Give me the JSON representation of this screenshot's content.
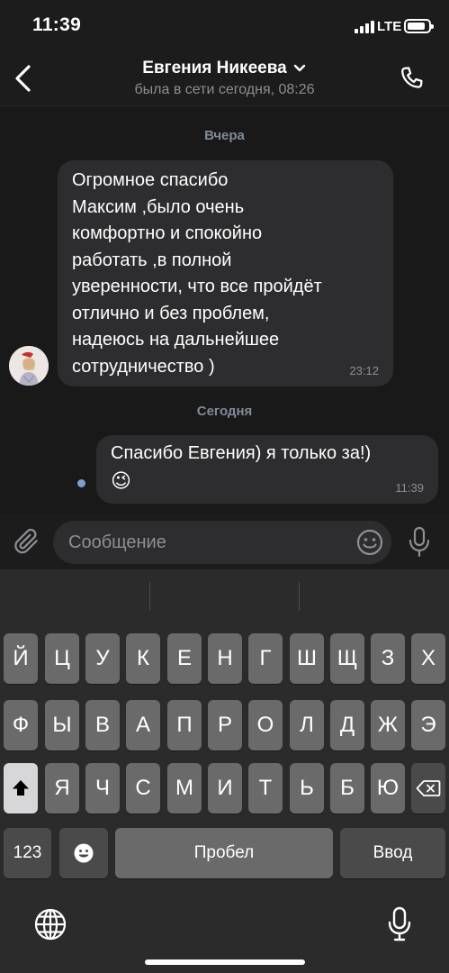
{
  "status_bar": {
    "time": "11:39",
    "network": "LTE"
  },
  "header": {
    "contact_name": "Евгения Никеева",
    "last_seen": "была в сети сегодня, 08:26"
  },
  "chat": {
    "date_separators": [
      "Вчера",
      "Сегодня"
    ],
    "messages": [
      {
        "direction": "incoming",
        "lines": [
          "Огромное спасибо",
          "Максим ,было очень",
          "комфортно и спокойно",
          "работать ,в полной",
          "уверенности, что все пройдёт",
          "отлично и без проблем,",
          "надеюсь на дальнейшее",
          "сотрудничество )"
        ],
        "time": "23:12"
      },
      {
        "direction": "outgoing",
        "text": "Спасибо Евгения) я только за!)",
        "emoji": "😉",
        "time": "11:39",
        "status": "unread"
      }
    ]
  },
  "composer": {
    "placeholder": "Сообщение"
  },
  "keyboard": {
    "row1": [
      "Й",
      "Ц",
      "У",
      "К",
      "Е",
      "Н",
      "Г",
      "Ш",
      "Щ",
      "З",
      "Х"
    ],
    "row2": [
      "Ф",
      "Ы",
      "В",
      "А",
      "П",
      "Р",
      "О",
      "Л",
      "Д",
      "Ж",
      "Э"
    ],
    "row3": [
      "Я",
      "Ч",
      "С",
      "М",
      "И",
      "Т",
      "Ь",
      "Б",
      "Ю"
    ],
    "numbers_key": "123",
    "space_label": "Пробел",
    "return_label": "Ввод"
  },
  "colors": {
    "background": "#19191a",
    "bubble": "#2d2d2f",
    "date_separator": "#7f8b99",
    "unread_dot": "#7c9ed3",
    "key": "#6a6a6a",
    "key_dark": "#4a4a4a"
  }
}
